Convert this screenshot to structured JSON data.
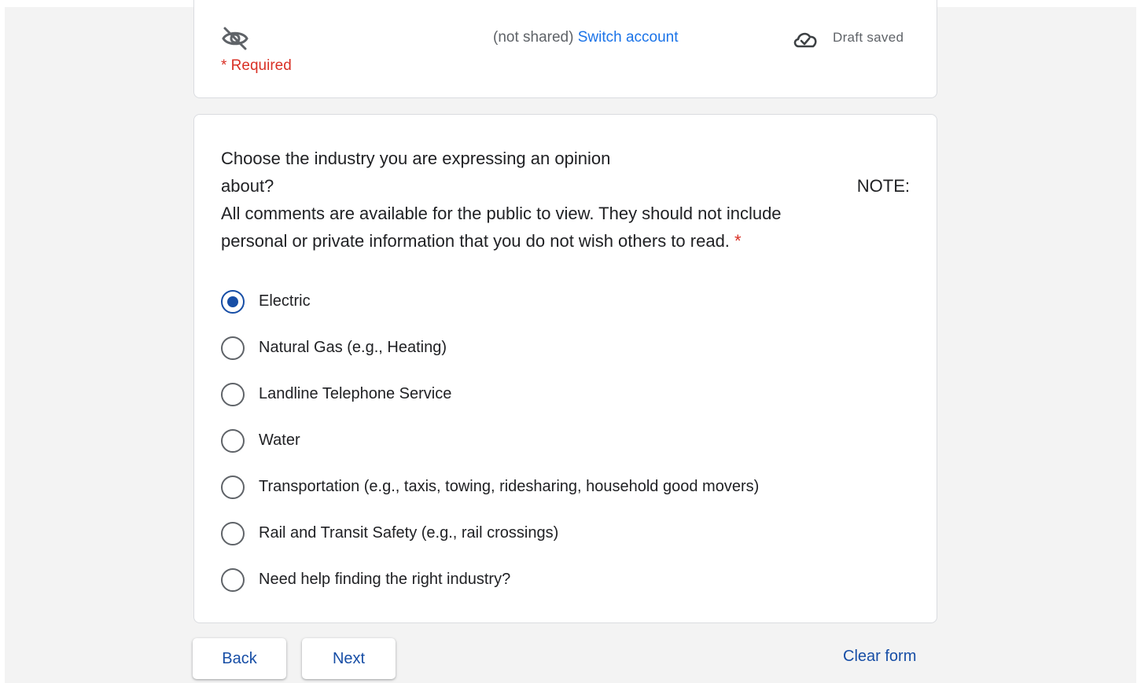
{
  "header": {
    "account_status": "(not shared)",
    "switch_account_label": "Switch account",
    "draft_status": "Draft saved",
    "required_note": "* Required",
    "eye_icon": "eye-off-icon",
    "cloud_icon": "cloud-done-icon"
  },
  "question": {
    "title_line1": "Choose the industry you are expressing an opinion",
    "title_line2": "about?",
    "note_label": "NOTE:",
    "title_line3": "All comments are available for the public to view. They should not include",
    "title_line4": "personal or private information that you do not wish others to read.",
    "required_marker": "*",
    "options": [
      {
        "label": "Electric",
        "selected": true
      },
      {
        "label": "Natural Gas (e.g., Heating)",
        "selected": false
      },
      {
        "label": "Landline Telephone Service",
        "selected": false
      },
      {
        "label": "Water",
        "selected": false
      },
      {
        "label": "Transportation (e.g., taxis, towing, ridesharing, household good movers)",
        "selected": false
      },
      {
        "label": "Rail and Transit Safety (e.g., rail crossings)",
        "selected": false
      },
      {
        "label": "Need help finding the right industry?",
        "selected": false
      }
    ]
  },
  "footer": {
    "back_label": "Back",
    "next_label": "Next",
    "clear_label": "Clear form"
  },
  "colors": {
    "accent": "#174ea6",
    "link": "#1a73e8",
    "required": "#d93025",
    "background": "#f3f3f3"
  }
}
